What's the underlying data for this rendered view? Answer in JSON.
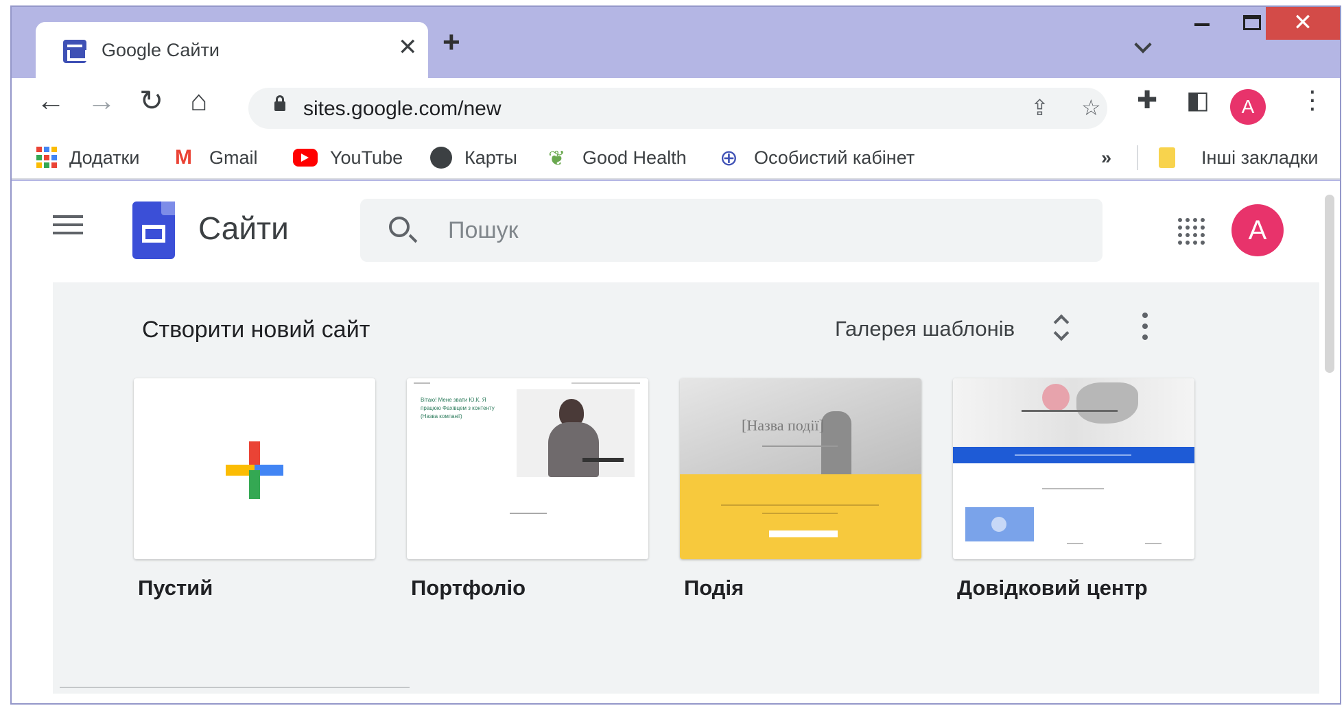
{
  "browser": {
    "tab_title": "Google Сайти",
    "url": "sites.google.com/new",
    "profile_initial": "A"
  },
  "bookmarks": [
    {
      "label": "Додатки",
      "icon": "apps-grid-icon"
    },
    {
      "label": "Gmail",
      "icon": "gmail-icon"
    },
    {
      "label": "YouTube",
      "icon": "youtube-icon"
    },
    {
      "label": "Карты",
      "icon": "globe-icon"
    },
    {
      "label": "Good Health",
      "icon": "leaf-icon"
    },
    {
      "label": "Особистий кабінет",
      "icon": "cabinet-icon"
    }
  ],
  "bookmarks_overflow": "»",
  "other_bookmarks": "Інші закладки",
  "app": {
    "title": "Сайти",
    "search_placeholder": "Пошук",
    "avatar_initial": "A"
  },
  "gallery": {
    "title": "Створити новий сайт",
    "templates_label": "Галерея шаблонів",
    "cards": [
      {
        "label": "Пустий"
      },
      {
        "label": "Портфоліо"
      },
      {
        "label": "Подія"
      },
      {
        "label": "Довідковий центр"
      }
    ]
  },
  "thumbnails": {
    "portfolio_text": "Вітаю! Мене звати Ю.К. Я працюю Фахівцем з контенту (Назва компанії)",
    "event_title": "[Назва події]"
  },
  "colors": {
    "window_frame": "#b4b6e4",
    "accent_avatar": "#e8336b",
    "sites_blue": "#3b4fd7",
    "close_red": "#d34b48"
  }
}
